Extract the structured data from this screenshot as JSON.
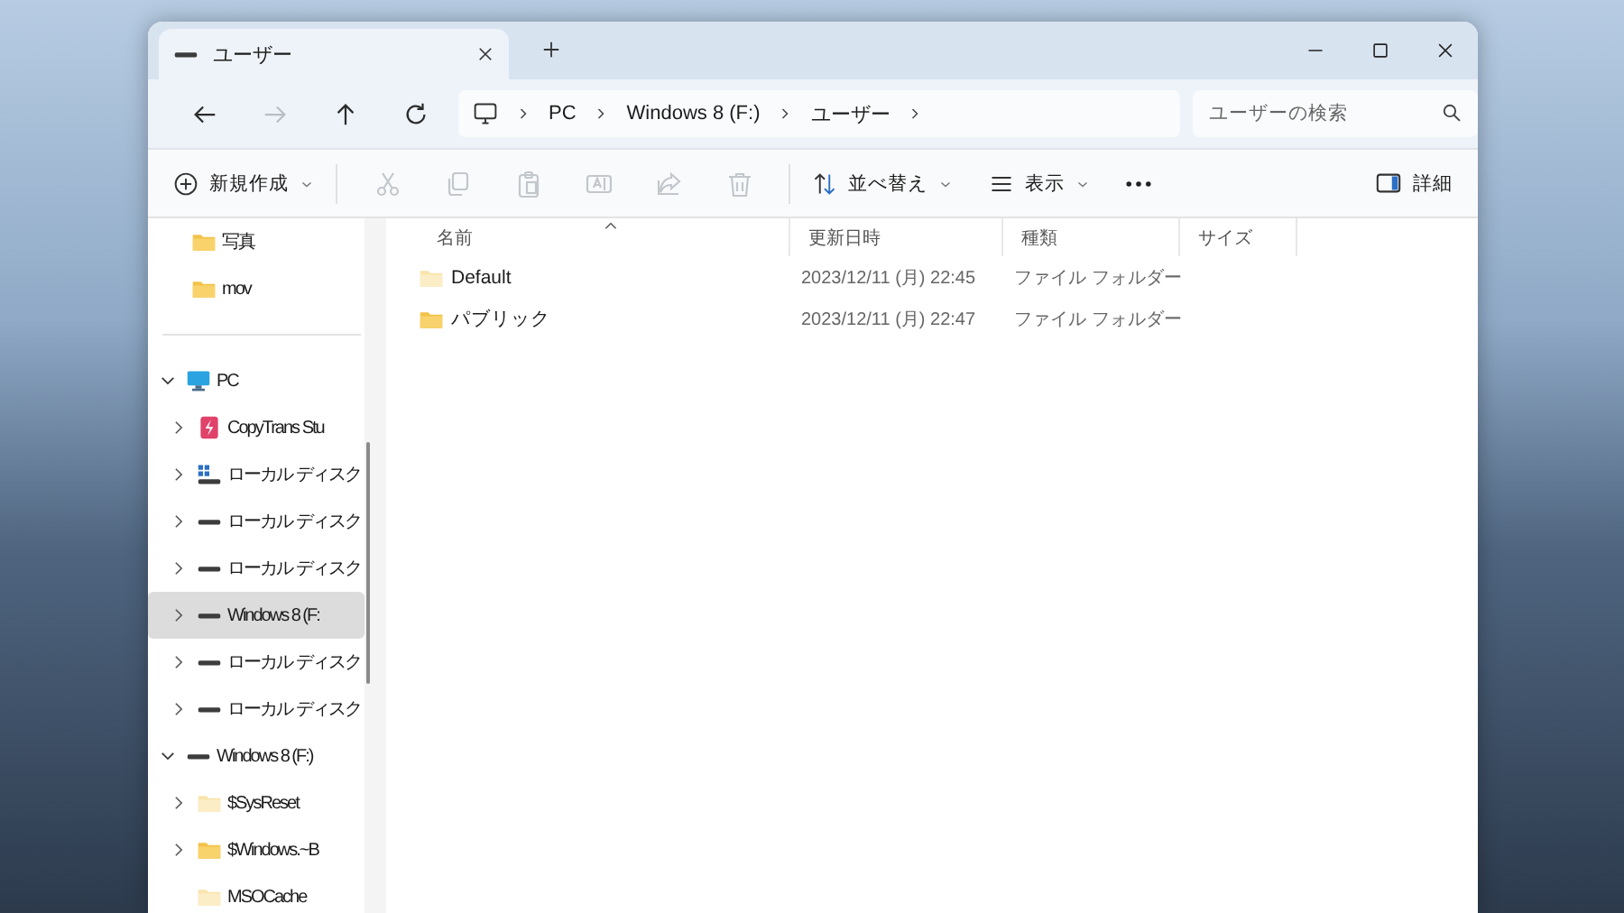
{
  "window": {
    "tab": {
      "title": "ユーザー",
      "selected": true
    }
  },
  "navigation": [
    {
      "kind": "back",
      "disabled": false
    },
    {
      "kind": "forward",
      "disabled": true
    },
    {
      "kind": "up",
      "disabled": false
    },
    {
      "kind": "refresh",
      "disabled": false
    }
  ],
  "breadcrumb": [
    "PC",
    "Windows 8 (F:)",
    "ユーザー"
  ],
  "search": {
    "placeholder": "ユーザーの検索"
  },
  "toolbar": {
    "new": "新規作成",
    "actions": [
      {
        "kind": "cut",
        "disabled": true
      },
      {
        "kind": "copy",
        "disabled": true
      },
      {
        "kind": "paste",
        "disabled": true
      },
      {
        "kind": "rename",
        "disabled": true
      },
      {
        "kind": "share",
        "disabled": true
      },
      {
        "kind": "delete",
        "disabled": true
      }
    ],
    "sort": "並べ替え",
    "view": "表示",
    "details": "詳細"
  },
  "sidebar": {
    "quick_access": [
      {
        "label": "写真",
        "kind": "folder"
      },
      {
        "label": "mov",
        "kind": "folder"
      }
    ],
    "tree": [
      {
        "label": "PC",
        "kind": "pc",
        "expandable": true,
        "expanded": true,
        "selected": false,
        "hidden": false,
        "children": [
          {
            "label": "CopyTrans Stu",
            "kind": "app",
            "expandable": true,
            "expanded": false,
            "selected": false,
            "hidden": false
          },
          {
            "label": "ローカル ディスク",
            "kind": "system-drive",
            "expandable": true,
            "expanded": false,
            "selected": false,
            "hidden": false
          },
          {
            "label": "ローカル ディスク",
            "kind": "drive",
            "expandable": true,
            "expanded": false,
            "selected": false,
            "hidden": false
          },
          {
            "label": "ローカル ディスク",
            "kind": "drive",
            "expandable": true,
            "expanded": false,
            "selected": false,
            "hidden": false
          },
          {
            "label": "Windows 8 (F:",
            "kind": "drive",
            "expandable": true,
            "expanded": false,
            "selected": true,
            "hidden": false
          },
          {
            "label": "ローカル ディスク",
            "kind": "drive",
            "expandable": true,
            "expanded": false,
            "selected": false,
            "hidden": false
          },
          {
            "label": "ローカル ディスク",
            "kind": "drive",
            "expandable": true,
            "expanded": false,
            "selected": false,
            "hidden": false
          }
        ]
      },
      {
        "label": "Windows 8 (F:)",
        "kind": "drive",
        "expandable": true,
        "expanded": true,
        "selected": false,
        "hidden": false,
        "children": [
          {
            "label": "$SysReset",
            "kind": "folder",
            "expandable": true,
            "expanded": false,
            "selected": false,
            "hidden": true
          },
          {
            "label": "$Windows.~B",
            "kind": "folder",
            "expandable": true,
            "expanded": false,
            "selected": false,
            "hidden": false
          },
          {
            "label": "MSOCache",
            "kind": "folder",
            "expandable": false,
            "expanded": false,
            "selected": false,
            "hidden": true
          }
        ]
      }
    ]
  },
  "table": {
    "columns": [
      "名前",
      "更新日時",
      "種類",
      "サイズ"
    ],
    "rows": [
      {
        "name": "Default",
        "modified": "2023/12/11 (月) 22:45",
        "type": "ファイル フォルダー",
        "hidden": true
      },
      {
        "name": "パブリック",
        "modified": "2023/12/11 (月) 22:47",
        "type": "ファイル フォルダー",
        "hidden": false
      }
    ]
  }
}
